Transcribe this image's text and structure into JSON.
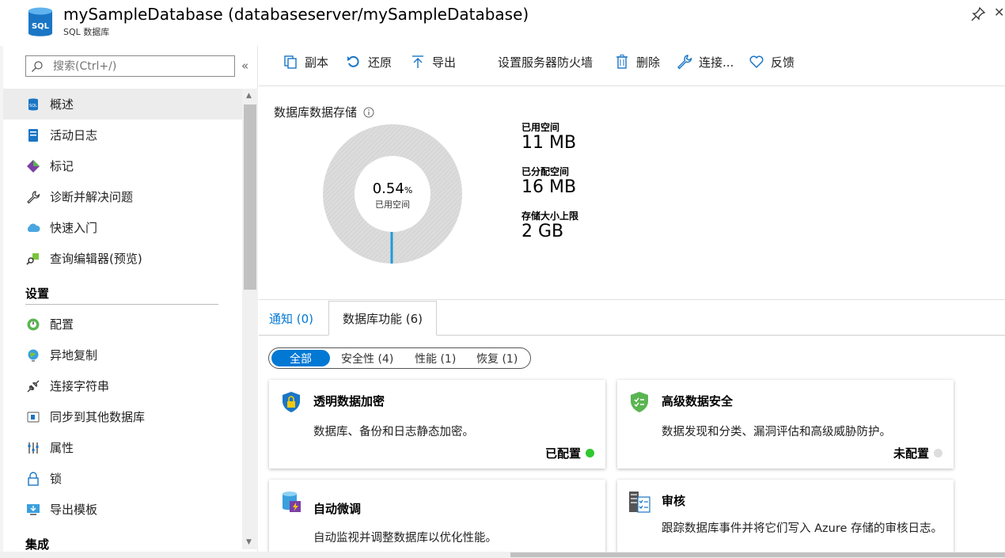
{
  "header": {
    "title": "mySampleDatabase (databaseserver/mySampleDatabase)",
    "subtitle": "SQL 数据库",
    "logo_text": "SQL"
  },
  "sidebar": {
    "search_placeholder": "搜索(Ctrl+/)",
    "collapse_glyph": "«",
    "items": [
      {
        "label": "概述",
        "icon": "sql-database-icon",
        "active": true
      },
      {
        "label": "活动日志",
        "icon": "activity-log-icon"
      },
      {
        "label": "标记",
        "icon": "tag-icon"
      },
      {
        "label": "诊断并解决问题",
        "icon": "wrench-icon"
      },
      {
        "label": "快速入门",
        "icon": "cloud-icon"
      }
    ],
    "items2": [
      {
        "label": "查询编辑器(预览)",
        "icon": "query-editor-icon"
      }
    ],
    "section_settings": "设置",
    "settings_items": [
      {
        "label": "配置",
        "icon": "configure-icon"
      },
      {
        "label": "异地复制",
        "icon": "globe-icon"
      },
      {
        "label": "连接字符串",
        "icon": "plug-icon"
      },
      {
        "label": "同步到其他数据库",
        "icon": "sync-icon"
      },
      {
        "label": "属性",
        "icon": "properties-icon"
      },
      {
        "label": "锁",
        "icon": "lock-icon"
      },
      {
        "label": "导出模板",
        "icon": "export-template-icon"
      }
    ],
    "next_section_partial": "集成"
  },
  "toolbar": {
    "copy": "副本",
    "restore": "还原",
    "export": "导出",
    "firewall": "设置服务器防火墙",
    "delete": "删除",
    "connect": "连接...",
    "feedback": "反馈"
  },
  "storage": {
    "title": "数据库数据存储",
    "used_percent": 0.54,
    "used_percent_text": "0.54",
    "percent_sign": "%",
    "used_sub": "已用空间",
    "used_label": "已用空间",
    "used_value": "11 MB",
    "allocated_label": "已分配空间",
    "allocated_value": "16 MB",
    "max_label": "存储大小上限",
    "max_value": "2 GB",
    "colors": {
      "track": "#dcdcdc",
      "used": "#1e9bd7"
    }
  },
  "tabs": {
    "notifications": "通知 (0)",
    "features": "数据库功能 (6)"
  },
  "filters": {
    "all": "全部",
    "security": "安全性 (4)",
    "performance": "性能 (1)",
    "recovery": "恢复 (1)"
  },
  "cards": [
    {
      "title": "透明数据加密",
      "desc": "数据库、备份和日志静态加密。",
      "status": "已配置",
      "status_color": "#2fc92f",
      "icon": "shield-lock-icon"
    },
    {
      "title": "高级数据安全",
      "desc": "数据发现和分类、漏洞评估和高级威胁防护。",
      "status": "未配置",
      "status_color": "#dddddd",
      "icon": "shield-check-icon"
    },
    {
      "title": "自动微调",
      "desc": "自动监视并调整数据库以优化性能。",
      "icon": "auto-tuning-icon"
    },
    {
      "title": "审核",
      "desc": "跟踪数据库事件并将它们写入 Azure 存储的审核日志。",
      "icon": "audit-icon"
    }
  ]
}
